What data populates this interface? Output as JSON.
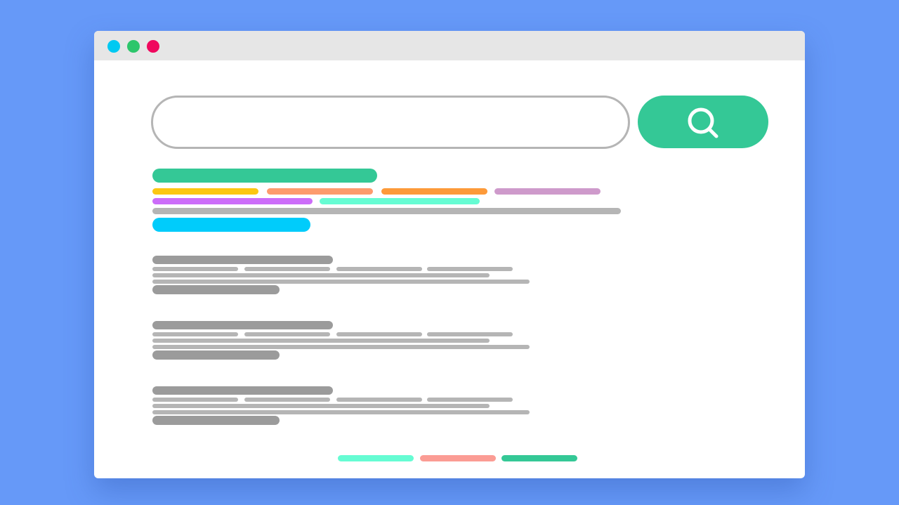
{
  "window": {
    "traffic_lights": [
      {
        "name": "traffic-light-cyan",
        "color": "#00c9f2"
      },
      {
        "name": "traffic-light-green",
        "color": "#2dc66b"
      },
      {
        "name": "traffic-light-pink",
        "color": "#f0085e"
      }
    ]
  },
  "search": {
    "value": "",
    "placeholder": "",
    "button_icon": "search-icon",
    "button_color": "#34c896"
  },
  "colors": {
    "featured_title": "#34c896",
    "featured_tags": [
      "#fcc712",
      "#fd9b6d",
      "#fd9a39",
      "#ce9acb",
      "#cc6cf9",
      "#66fcd3"
    ],
    "featured_snippet": "#b5b5b5",
    "featured_link": "#00ccfb",
    "result_title": "#9b9b9b",
    "result_lines": "#b5b5b5",
    "pagination": [
      "#66fcd3",
      "#fb9c94",
      "#34c896"
    ]
  },
  "results_count": 3,
  "pagination_count": 3
}
